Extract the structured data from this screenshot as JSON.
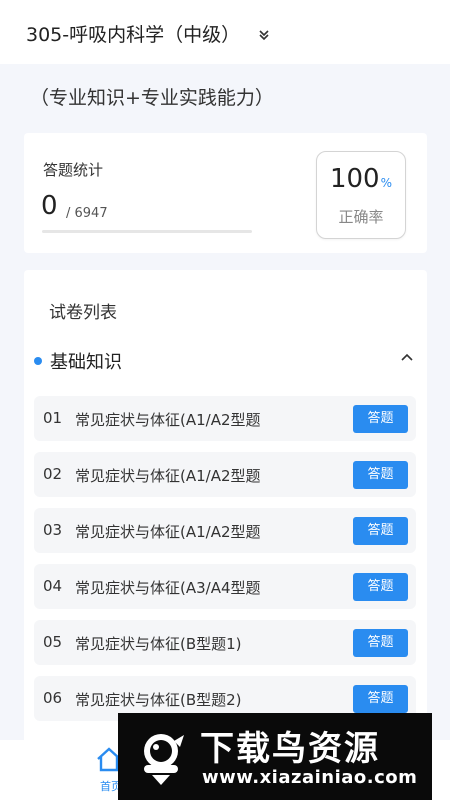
{
  "header": {
    "course_title": "305-呼吸内科学（中级）",
    "course_dropdown_icon": "double-chevron-down-icon"
  },
  "subtitle": "（专业知识+专业实践能力）",
  "stats": {
    "label": "答题统计",
    "answered": "0",
    "total": "/ 6947",
    "progress_fraction": 0,
    "rate_value": "100",
    "rate_unit": "%",
    "rate_caption": "正确率"
  },
  "paper_list": {
    "title": "试卷列表",
    "section": {
      "name": "基础知识",
      "collapse_icon": "chevron-up-icon"
    },
    "items": [
      {
        "num": "01",
        "title": "常见症状与体征(A1/A2型题",
        "button": "答题"
      },
      {
        "num": "02",
        "title": "常见症状与体征(A1/A2型题",
        "button": "答题"
      },
      {
        "num": "03",
        "title": "常见症状与体征(A1/A2型题",
        "button": "答题"
      },
      {
        "num": "04",
        "title": "常见症状与体征(A3/A4型题",
        "button": "答题"
      },
      {
        "num": "05",
        "title": "常见症状与体征(B型题1)",
        "button": "答题"
      },
      {
        "num": "06",
        "title": "常见症状与体征(B型题2)",
        "button": "答题"
      }
    ]
  },
  "tabbar": {
    "home_label": "首页",
    "home_icon": "home-icon"
  },
  "watermark": {
    "brand": "下载鸟资源",
    "url": "www.xiazainiao.com",
    "logo_icon": "bird-logo-icon"
  },
  "colors": {
    "accent": "#2a8cf0",
    "background": "#f4f6fb"
  }
}
